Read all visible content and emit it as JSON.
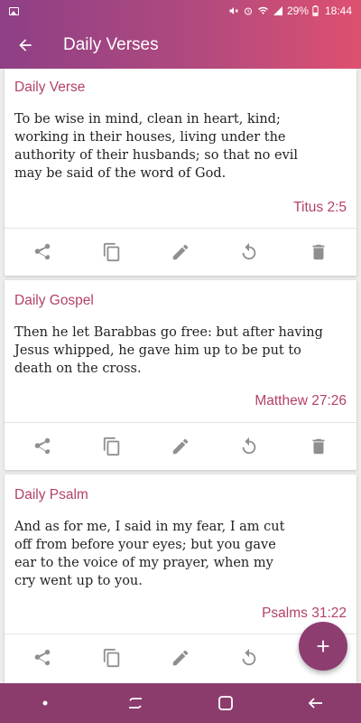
{
  "status_bar": {
    "battery": "29%",
    "time": "18:44"
  },
  "app_bar": {
    "title": "Daily Verses"
  },
  "cards": [
    {
      "title": "Daily Verse",
      "lines": [
        "To be wise in mind, clean in heart, kind;",
        "working in their houses, living under the",
        "authority of their husbands; so that no evil",
        "may be said of the word of God."
      ],
      "reference": "Titus 2:5"
    },
    {
      "title": "Daily Gospel",
      "lines": [
        "Then he let Barabbas go free: but after having",
        "Jesus whipped, he gave him up to be put to",
        "death on the cross."
      ],
      "reference": "Matthew 27:26"
    },
    {
      "title": "Daily Psalm",
      "lines": [
        "And as for me, I said in my fear, I am cut",
        "off from before your eyes; but you gave",
        "ear to the voice of my prayer, when my",
        "cry went up to you."
      ],
      "reference": "Psalms 31:22"
    }
  ],
  "card_actions": [
    "share-icon",
    "copy-icon",
    "edit-icon",
    "refresh-icon",
    "delete-icon"
  ],
  "fab": {
    "icon": "plus-icon"
  },
  "nav_bar": {
    "buttons": [
      "dot-icon",
      "recent-apps-icon",
      "home-icon",
      "back-icon"
    ]
  },
  "colors": {
    "gradient_start": "#8e3f86",
    "gradient_end": "#de5070",
    "accent": "#b3416b",
    "fab": "#8e3d70",
    "nav_bar": "#8b3c6d",
    "action_icon": "#8f8f8f"
  }
}
